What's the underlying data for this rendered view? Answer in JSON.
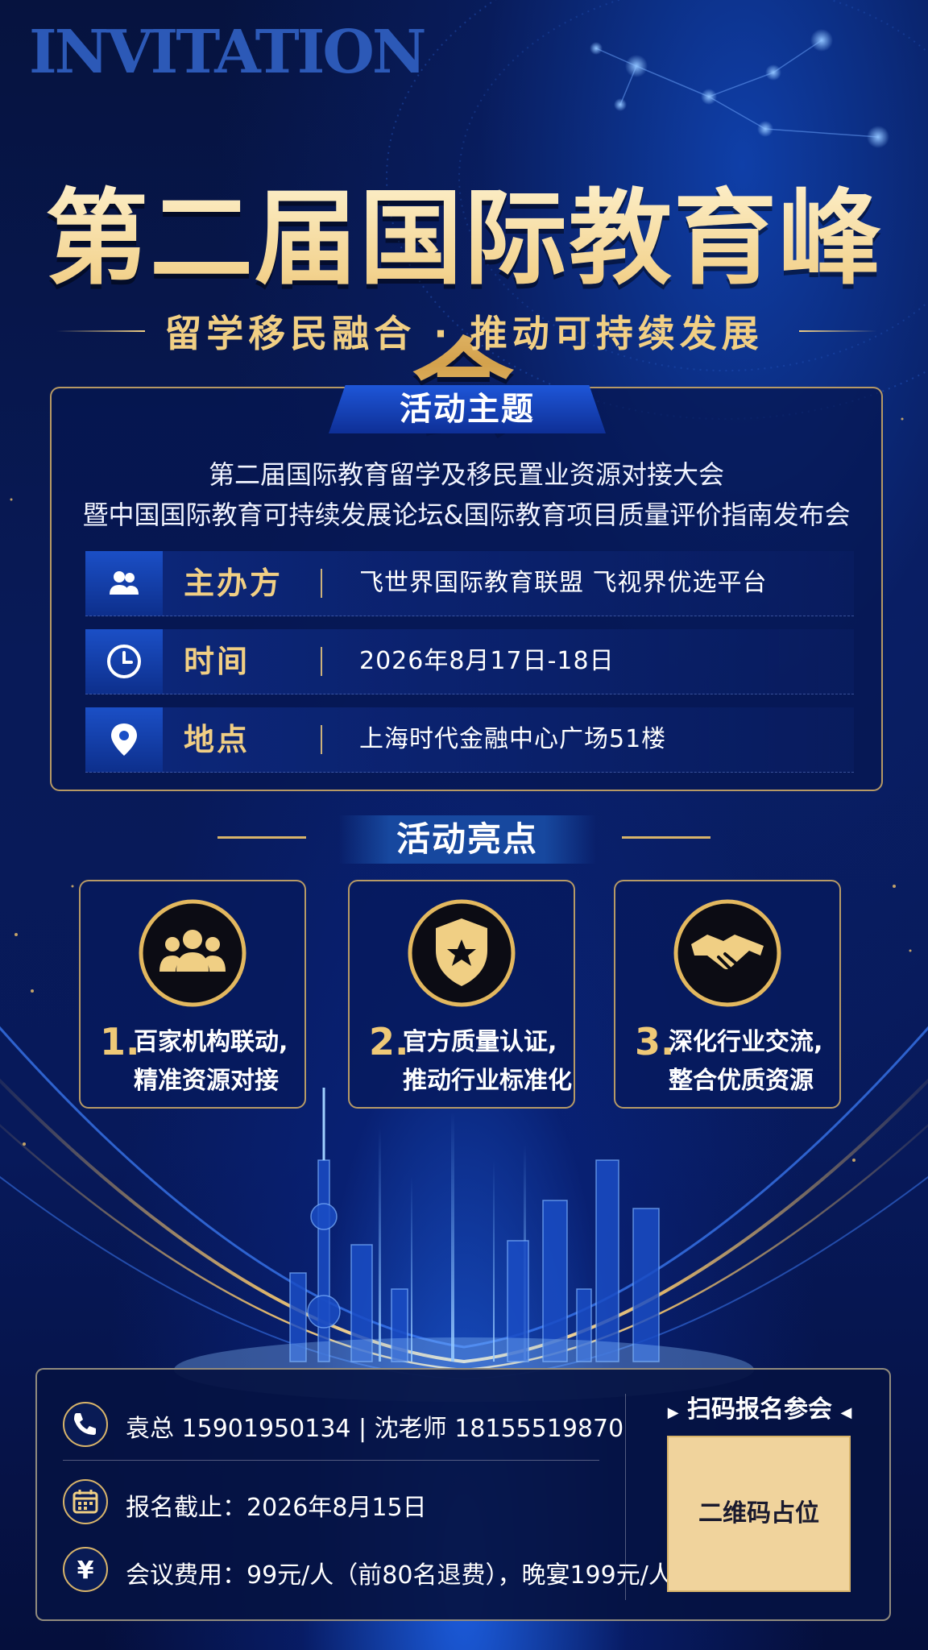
{
  "header": {
    "watermark": "INVITATION",
    "title": "第二届国际教育峰会",
    "subtitle": "留学移民融合 · 推动可持续发展"
  },
  "theme": {
    "tab_label": "活动主题",
    "line1": "第二届国际教育留学及移民置业资源对接大会",
    "line2": "暨中国国际教育可持续发展论坛&国际教育项目质量评价指南发布会",
    "rows": [
      {
        "icon": "people-icon",
        "label": "主办方",
        "value": "飞世界国际教育联盟  飞视界优选平台"
      },
      {
        "icon": "clock-icon",
        "label": "时间",
        "value": "2026年8月17日-18日"
      },
      {
        "icon": "location-pin-icon",
        "label": "地点",
        "value": "上海时代金融中心广场51楼"
      }
    ]
  },
  "highlights": {
    "tab_label": "活动亮点",
    "items": [
      {
        "icon": "group-icon",
        "num": "1.",
        "line1": "百家机构联动,",
        "line2": "精准资源对接"
      },
      {
        "icon": "shield-star-icon",
        "num": "2.",
        "line1": "官方质量认证,",
        "line2": "推动行业标准化"
      },
      {
        "icon": "handshake-icon",
        "num": "3.",
        "line1": "深化行业交流,",
        "line2": "整合优质资源"
      }
    ]
  },
  "contact": {
    "phone_line": "袁总  15901950134  |  沈老师  18155519870",
    "deadline": "报名截止：2026年8月15日",
    "fee": "会议费用：99元/人（前80名退费），晚宴199元/人",
    "scan_title": "扫码报名参会",
    "qr_placeholder": "二维码占位"
  },
  "colors": {
    "gold": "#f1cf84",
    "navy": "#06133f",
    "accent_blue": "#1e56d8"
  }
}
